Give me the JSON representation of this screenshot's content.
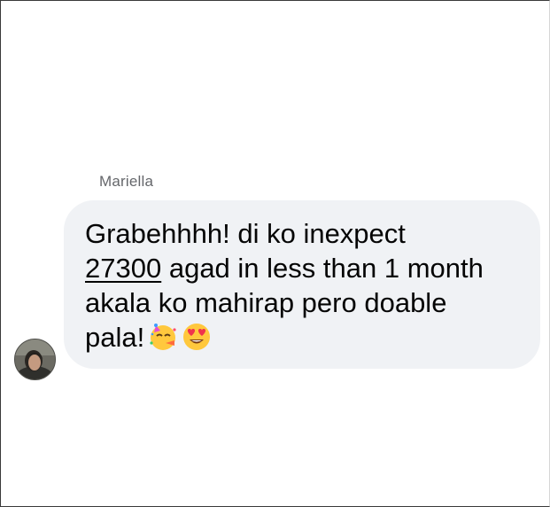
{
  "message": {
    "sender": "Mariella",
    "lines": {
      "line1": "Grabehhhh! di ko inexpect",
      "line2_link": "27300",
      "line2_rest": " agad in less than 1 month",
      "line3": "akala ko mahirap pero doable",
      "line4": "pala!"
    },
    "emojis": [
      "partying-face-icon",
      "heart-eyes-icon"
    ],
    "bubble_color": "#f0f2f5",
    "text_color": "#050505",
    "sender_color": "#65676b"
  }
}
